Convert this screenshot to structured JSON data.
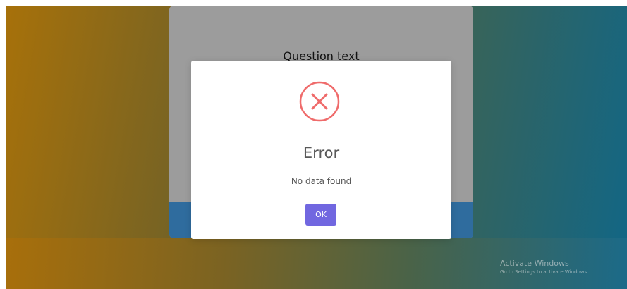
{
  "quiz": {
    "question_text": "Question text"
  },
  "dialog": {
    "icon": "error-x-circle-icon",
    "title": "Error",
    "message": "No data found",
    "ok_label": "OK",
    "colors": {
      "icon": "#ef6b6b",
      "button": "#7167e0"
    }
  },
  "watermark": {
    "title": "Activate Windows",
    "subtitle": "Go to Settings to activate Windows."
  }
}
